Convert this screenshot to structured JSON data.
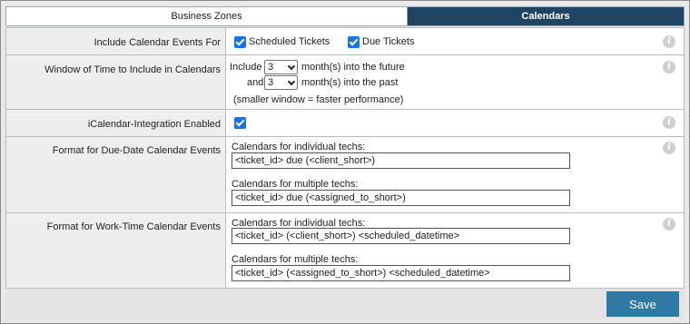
{
  "tabs": [
    {
      "label": "Business Zones",
      "active": false
    },
    {
      "label": "Calendars",
      "active": true
    }
  ],
  "rows": {
    "include_events": {
      "label": "Include Calendar Events For",
      "scheduled_label": "Scheduled Tickets",
      "scheduled_checked": true,
      "due_label": "Due Tickets",
      "due_checked": true
    },
    "window": {
      "label": "Window of Time to Include in Calendars",
      "include_text": "Include",
      "future_value": "3",
      "future_text": "month(s) into the future",
      "and_text": "and",
      "past_value": "3",
      "past_text": "month(s) into the past",
      "note": "(smaller window = faster performance)"
    },
    "icalendar": {
      "label": "iCalendar-Integration Enabled",
      "checked": true
    },
    "due_format": {
      "label": "Format for Due-Date Calendar Events",
      "individual_label": "Calendars for individual techs:",
      "individual_value": "<ticket_id> due (<client_short>)",
      "multiple_label": "Calendars for multiple techs:",
      "multiple_value": "<ticket_id> due (<assigned_to_short>)"
    },
    "work_format": {
      "label": "Format for Work-Time Calendar Events",
      "individual_label": "Calendars for individual techs:",
      "individual_value": "<ticket_id> (<client_short>) <scheduled_datetime>",
      "multiple_label": "Calendars for multiple techs:",
      "multiple_value": "<ticket_id> (<assigned_to_short>) <scheduled_datetime>"
    }
  },
  "info_icon_glyph": "i",
  "save_label": "Save",
  "colors": {
    "active_tab": "#1f4562",
    "save_button": "#2e7aa5",
    "checkbox": "#1a73e8"
  }
}
